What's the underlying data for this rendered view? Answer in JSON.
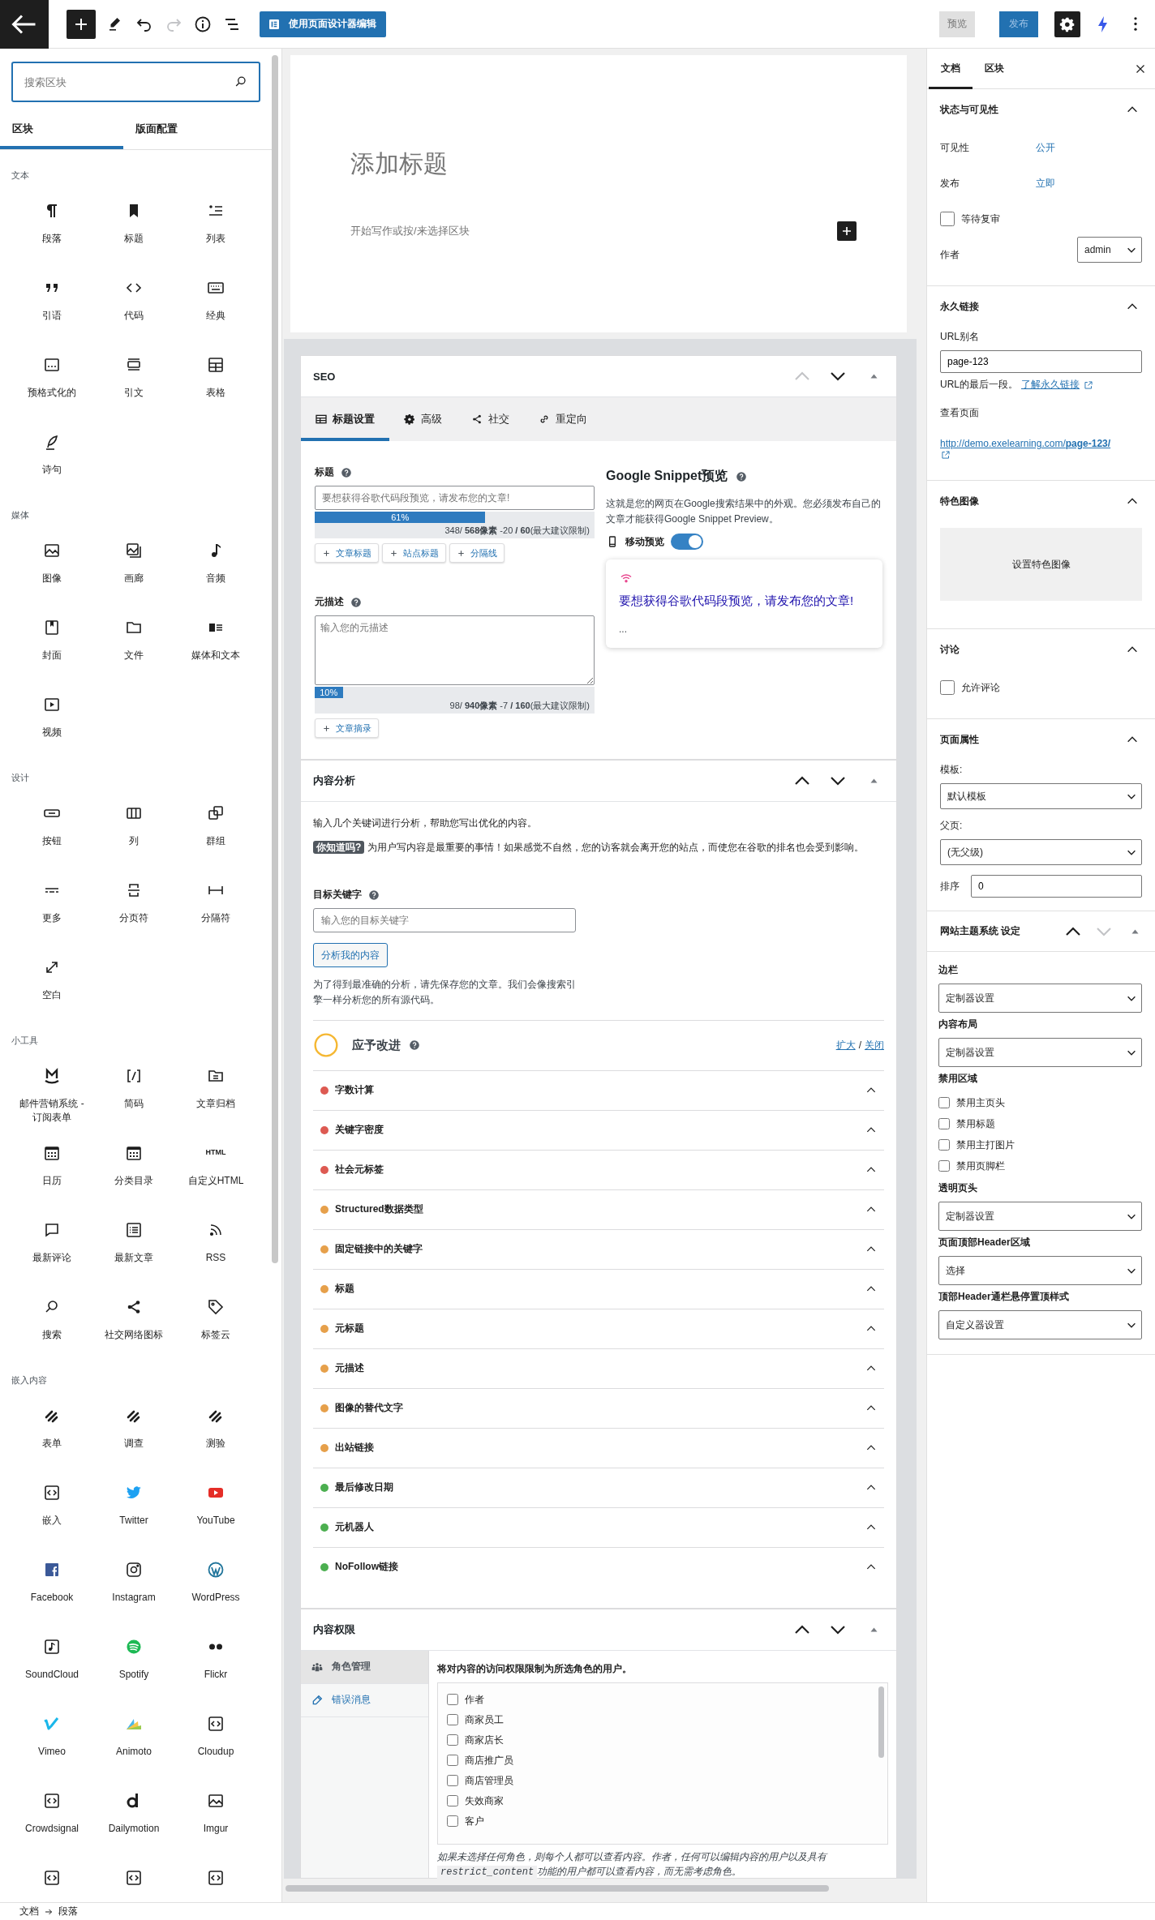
{
  "toolbar": {
    "redo": {
      "disabled": true
    },
    "designer_button": "使用页面设计器编辑",
    "preview_button": "预览",
    "publish_button": {
      "label": "发布",
      "disabled": true
    },
    "settings": {
      "pressed": true
    }
  },
  "inserter": {
    "search": {
      "placeholder": "搜索区块"
    },
    "tabs": [
      {
        "label": "区块",
        "selected": true
      },
      {
        "label": "版面配置",
        "selected": false
      }
    ],
    "categories": [
      {
        "title": "文本",
        "blocks": [
          {
            "label": "段落"
          },
          {
            "label": "标题"
          },
          {
            "label": "列表"
          },
          {
            "label": "引语"
          },
          {
            "label": "代码"
          },
          {
            "label": "经典"
          },
          {
            "label": "预格式化的"
          },
          {
            "label": "引文"
          },
          {
            "label": "表格"
          },
          {
            "label": "诗句"
          }
        ]
      },
      {
        "title": "媒体",
        "blocks": [
          {
            "label": "图像"
          },
          {
            "label": "画廊"
          },
          {
            "label": "音频"
          },
          {
            "label": "封面"
          },
          {
            "label": "文件"
          },
          {
            "label": "媒体和文本"
          },
          {
            "label": "视频"
          }
        ]
      },
      {
        "title": "设计",
        "blocks": [
          {
            "label": "按钮"
          },
          {
            "label": "列"
          },
          {
            "label": "群组"
          },
          {
            "label": "更多"
          },
          {
            "label": "分页符"
          },
          {
            "label": "分隔符"
          },
          {
            "label": "空白"
          }
        ]
      },
      {
        "title": "小工具",
        "blocks": [
          {
            "label": "邮件营销系统 - 订阅表单"
          },
          {
            "label": "简码"
          },
          {
            "label": "文章归档"
          },
          {
            "label": "日历"
          },
          {
            "label": "分类目录"
          },
          {
            "label": "自定义HTML",
            "icon_text": "HTML"
          },
          {
            "label": "最新评论"
          },
          {
            "label": "最新文章"
          },
          {
            "label": "RSS"
          },
          {
            "label": "搜索"
          },
          {
            "label": "社交网络图标"
          },
          {
            "label": "标签云"
          }
        ]
      },
      {
        "title": "嵌入内容",
        "blocks": [
          {
            "label": "表单"
          },
          {
            "label": "调查"
          },
          {
            "label": "测验"
          },
          {
            "label": "嵌入"
          },
          {
            "label": "Twitter"
          },
          {
            "label": "YouTube"
          },
          {
            "label": "Facebook"
          },
          {
            "label": "Instagram"
          },
          {
            "label": "WordPress"
          },
          {
            "label": "SoundCloud"
          },
          {
            "label": "Spotify"
          },
          {
            "label": "Flickr"
          },
          {
            "label": "Vimeo"
          },
          {
            "label": "Animoto"
          },
          {
            "label": "Cloudup"
          },
          {
            "label": "Crowdsignal"
          },
          {
            "label": "Dailymotion"
          },
          {
            "label": "Imgur"
          },
          {
            "kind": "cut_off"
          },
          {
            "kind": "cut_off"
          },
          {
            "kind": "cut_off"
          }
        ]
      }
    ]
  },
  "editor": {
    "title_placeholder": "添加标题",
    "body_placeholder": "开始写作或按/来选择区块"
  },
  "seo": {
    "title": "SEO",
    "move_up": {
      "disabled": true
    },
    "move_down": {
      "disabled": false
    },
    "tabs": [
      {
        "label": "标题设置",
        "selected": true
      },
      {
        "label": "高级",
        "selected": false
      },
      {
        "label": "社交",
        "selected": false
      },
      {
        "label": "重定向",
        "selected": false
      }
    ],
    "title_field": {
      "label": "标题",
      "placeholder": "要想获得谷歌代码段预览，请发布您的文章!",
      "level": 0.61,
      "percent": "61%",
      "reading": "348/ **568像素** -20 **/ 60**(最大建议限制)",
      "tags": [
        "文章标题",
        "站点标题",
        "分隔线"
      ]
    },
    "description_field": {
      "label": "元描述",
      "placeholder": "输入您的元描述",
      "level": 0.1,
      "percent": "10%",
      "reading": "98/ **940像素** -7 **/ 160**(最大建议限制)",
      "tags": [
        "文章摘录"
      ]
    },
    "snippet": {
      "title": "Google Snippet预览",
      "description": "这就是您的网页在Google搜索结果中的外观。您必须发布自己的文章才能获得Google Snippet Preview。",
      "mobile_label": "移动预览",
      "mobile_on": true,
      "preview_title": "要想获得谷歌代码段预览，请发布您的文章!",
      "preview_description": "..."
    }
  },
  "content_analysis": {
    "title": "内容分析",
    "move_up": {
      "disabled": false
    },
    "move_down": {
      "disabled": false
    },
    "intro": "输入几个关键词进行分析，帮助您写出优化的内容。",
    "tip_badge": "你知道吗?",
    "tip": "为用户写内容是最重要的事情！如果感觉不自然，您的访客就会离开您的站点，而使您在谷歌的排名也会受到影响。",
    "keyword": {
      "label": "目标关键字",
      "placeholder": "输入您的目标关键字"
    },
    "analyze_button": "分析我的内容",
    "note": "为了得到最准确的分析，请先保存您的文章。我们会像搜索引擎一样分析您的所有源代码。",
    "status": "应予改进",
    "expand_link": "扩大",
    "link_separator": "/",
    "collapse_link": "关闭",
    "checks": [
      {
        "label": "字数计算",
        "color": "#dd5a52"
      },
      {
        "label": "关键字密度",
        "color": "#dd5a52"
      },
      {
        "label": "社会元标签",
        "color": "#dd5a52"
      },
      {
        "label": "Structured数据类型",
        "color": "#e6a04b"
      },
      {
        "label": "固定链接中的关键字",
        "color": "#e6a04b"
      },
      {
        "label": "标题",
        "color": "#e6a04b"
      },
      {
        "label": "元标题",
        "color": "#e6a04b"
      },
      {
        "label": "元描述",
        "color": "#e6a04b"
      },
      {
        "label": "图像的替代文字",
        "color": "#e6a04b"
      },
      {
        "label": "出站链接",
        "color": "#e6a04b"
      },
      {
        "label": "最后修改日期",
        "color": "#4caf50"
      },
      {
        "label": "元机器人",
        "color": "#4caf50"
      },
      {
        "label": "NoFollow链接",
        "color": "#4caf50"
      }
    ]
  },
  "content_permissions": {
    "title": "内容权限",
    "move_up": {
      "disabled": false
    },
    "move_down": {
      "disabled": false
    },
    "tabs": [
      {
        "label": "角色管理",
        "selected": true
      },
      {
        "label": "错误消息",
        "selected": false
      }
    ],
    "heading": "将对内容的访问权限限制为所选角色的用户。",
    "roles": [
      {
        "label": "作者",
        "checked": false
      },
      {
        "label": "商家员工",
        "checked": false
      },
      {
        "label": "商家店长",
        "checked": false
      },
      {
        "label": "商店推广员",
        "checked": false
      },
      {
        "label": "商店管理员",
        "checked": false
      },
      {
        "label": "失效商家",
        "checked": false
      },
      {
        "label": "客户",
        "checked": false
      }
    ],
    "note": {
      "before": "如果未选择任何角色，则每个人都可以查看内容。作者，任何可以编辑内容的用户以及具有",
      "code": "restrict_content",
      "after": "功能的用户都可以查看内容，而无需考虑角色。"
    }
  },
  "breadcrumb": [
    "文档",
    "段落"
  ],
  "settings_sidebar": {
    "tabs": [
      {
        "label": "文档",
        "selected": true
      },
      {
        "label": "区块",
        "selected": false
      }
    ],
    "status": {
      "title": "状态与可见性",
      "expanded": true,
      "visibility_label": "可见性",
      "visibility": "公开",
      "publish_label": "发布",
      "publish": "立即",
      "pending_review": {
        "label": "等待复审",
        "checked": false
      },
      "author_label": "作者",
      "author": "admin"
    },
    "permalink": {
      "title": "永久链接",
      "expanded": true,
      "slug_label": "URL别名",
      "slug": "page-123",
      "hint": "URL的最后一段。",
      "learn_link": "了解永久链接",
      "view_label": "查看页面",
      "url": "http://demo.exelearning.com/**page-123/**"
    },
    "featured_image": {
      "title": "特色图像",
      "expanded": true,
      "button": "设置特色图像"
    },
    "discussion": {
      "title": "讨论",
      "expanded": true,
      "allow_comments": {
        "label": "允许评论",
        "checked": false
      }
    },
    "page_attributes": {
      "title": "页面属性",
      "expanded": true,
      "template_label": "模板:",
      "template": "默认模板",
      "parent_label": "父页:",
      "parent": "(无父级)",
      "order_label": "排序",
      "order": "0"
    },
    "theme_settings": {
      "title": "网站主题系统 设定",
      "move_up": {
        "disabled": false
      },
      "move_down": {
        "disabled": true
      },
      "sidebar_label": "边栏",
      "sidebar": "定制器设置",
      "layout_label": "内容布局",
      "layout": "定制器设置",
      "disable_label": "禁用区域",
      "disable": [
        {
          "label": "禁用主页头",
          "checked": false
        },
        {
          "label": "禁用标题",
          "checked": false
        },
        {
          "label": "禁用主打图片",
          "checked": false
        },
        {
          "label": "禁用页脚栏",
          "checked": false
        }
      ],
      "transparent_label": "透明页头",
      "transparent": "定制器设置",
      "header_area_label": "页面顶部Header区域",
      "header_area": "选择",
      "sticky_label": "顶部Header通栏悬停置顶样式",
      "sticky": "自定义器设置"
    }
  }
}
